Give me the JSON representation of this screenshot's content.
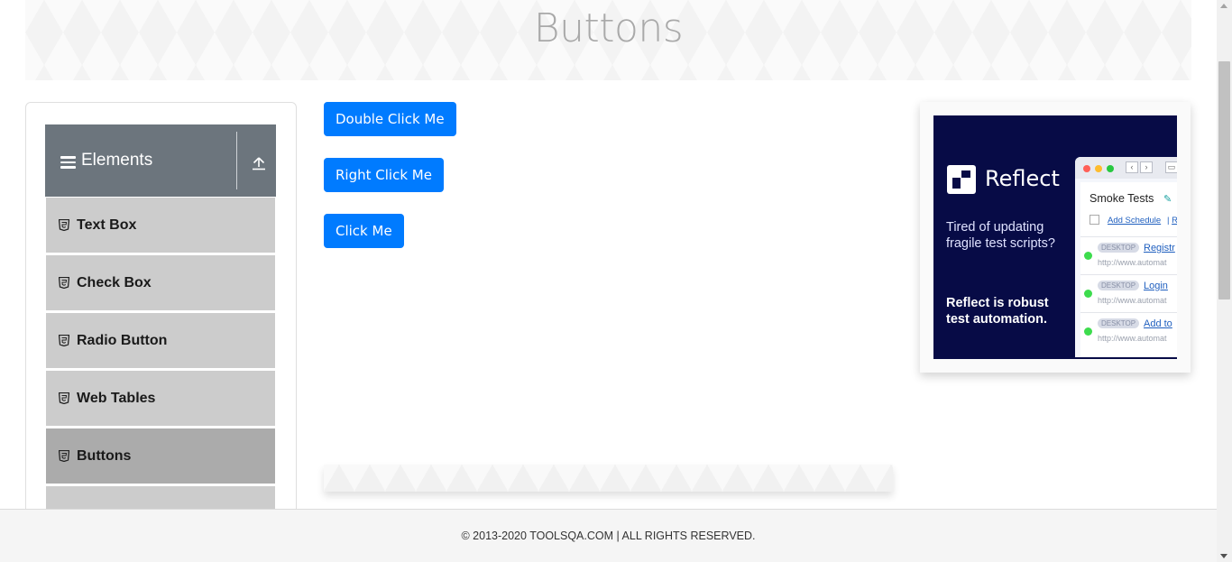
{
  "banner": {
    "title": "Buttons"
  },
  "sidebar": {
    "group_title": "Elements",
    "group_icon": "hamburger-icon",
    "collapse_icon": "upload-arrow-icon",
    "items": [
      {
        "label": "Text Box",
        "icon": "html5-icon",
        "active": false
      },
      {
        "label": "Check Box",
        "icon": "html5-icon",
        "active": false
      },
      {
        "label": "Radio Button",
        "icon": "html5-icon",
        "active": false
      },
      {
        "label": "Web Tables",
        "icon": "html5-icon",
        "active": false
      },
      {
        "label": "Buttons",
        "icon": "html5-icon",
        "active": true
      }
    ]
  },
  "buttons": {
    "double_click": "Double Click Me",
    "right_click": "Right Click Me",
    "click": "Click Me"
  },
  "ad": {
    "brand": "Reflect",
    "tagline": "Tired of updating fragile test scripts?",
    "pitch": "Reflect is robust test automation.",
    "panel_title": "Smoke Tests",
    "add_schedule": "Add Schedule",
    "run_fragment": "Ru",
    "rows": [
      {
        "badge": "DESKTOP",
        "link": "Registr",
        "url": "http://www.automat"
      },
      {
        "badge": "DESKTOP",
        "link": "Login",
        "url": "http://www.automat"
      },
      {
        "badge": "DESKTOP",
        "link": "Add to",
        "url": "http://www.automat"
      }
    ]
  },
  "footer": {
    "text": "© 2013-2020 TOOLSQA.COM | ALL RIGHTS RESERVED."
  },
  "colors": {
    "primary_button": "#007bff",
    "group_header": "#6c757d",
    "menu_item": "#cccccc",
    "menu_item_active": "#ababab",
    "ad_background": "#070b46"
  }
}
